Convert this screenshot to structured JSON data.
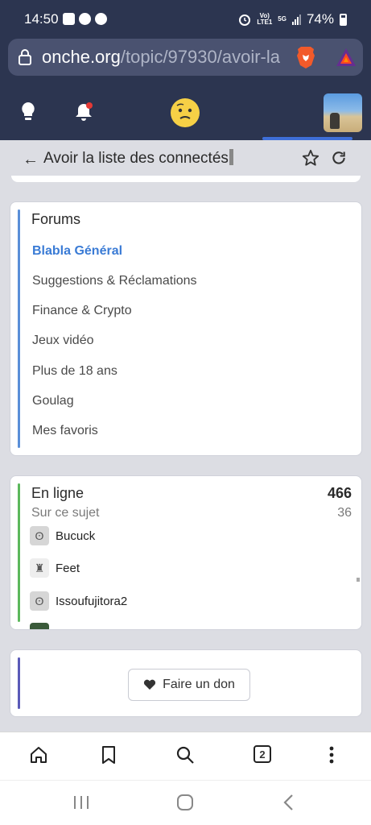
{
  "status_bar": {
    "time": "14:50",
    "network_top": "Vo)",
    "network_bottom": "LTE1",
    "network_gen": "5G",
    "battery": "74%"
  },
  "browser": {
    "url_host": "onche.org",
    "url_path": "/topic/97930/avoir-la"
  },
  "topic": {
    "title": "Avoir la liste des connectés"
  },
  "forums": {
    "title": "Forums",
    "items": [
      {
        "label": "Blabla Général"
      },
      {
        "label": "Suggestions & Réclamations"
      },
      {
        "label": "Finance & Crypto"
      },
      {
        "label": "Jeux vidéo"
      },
      {
        "label": "Plus de 18 ans"
      },
      {
        "label": "Goulag"
      },
      {
        "label": "Mes favoris"
      }
    ]
  },
  "online": {
    "title": "En ligne",
    "count": "466",
    "subject_label": "Sur ce sujet",
    "subject_count": "36",
    "users": [
      {
        "name": "Bucuck"
      },
      {
        "name": "Feet"
      },
      {
        "name": "Issoufujitora2"
      }
    ]
  },
  "donate": {
    "label": "Faire un don"
  },
  "toolbar": {
    "tab_count": "2"
  },
  "colors": {
    "header_bg": "#2c3550",
    "accent_blue": "#3a7bd5",
    "forums_stripe": "#5a8fd8",
    "online_stripe": "#5cb85c",
    "donate_stripe": "#5a5ab8"
  }
}
